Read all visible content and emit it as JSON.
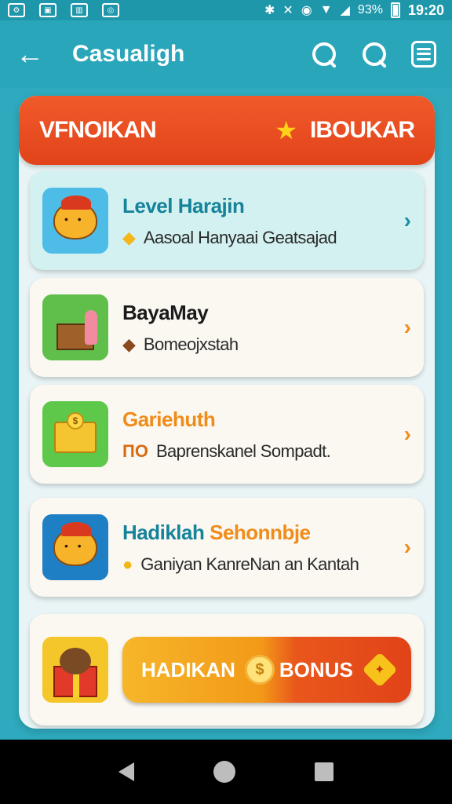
{
  "status_bar": {
    "battery_percent": "93%",
    "time": "19:20"
  },
  "app_bar": {
    "title": "Casualigh"
  },
  "banner": {
    "left_label": "VFNOIKAN",
    "right_label": "IBOUKAR"
  },
  "cards": [
    {
      "title": "Level Harajin",
      "subtitle": "Aasoal Hanyaai Geatsajad"
    },
    {
      "title": "BayaMay",
      "subtitle": "Bomeojxstah"
    },
    {
      "title": "Gariehuth",
      "sub_icon_text": "ПО",
      "subtitle": "Baprenskanel Sompadt."
    },
    {
      "title_a": "Hadiklah",
      "title_b": "Sehonnbje",
      "subtitle": "Ganiyan KanreNan an Kantah"
    }
  ],
  "bonus": {
    "left_label": "HADIKAN",
    "coin_symbol": "$",
    "right_label": "BONUS"
  },
  "icons": {
    "back": "arrow-left-icon",
    "search": "search-icon",
    "menu": "menu-icon",
    "star": "star-icon",
    "chevron": "chevron-right-icon"
  },
  "colors": {
    "background": "#2ea9bd",
    "banner": "#e2431a",
    "accent_orange": "#f08c1a",
    "accent_teal": "#15839a"
  }
}
